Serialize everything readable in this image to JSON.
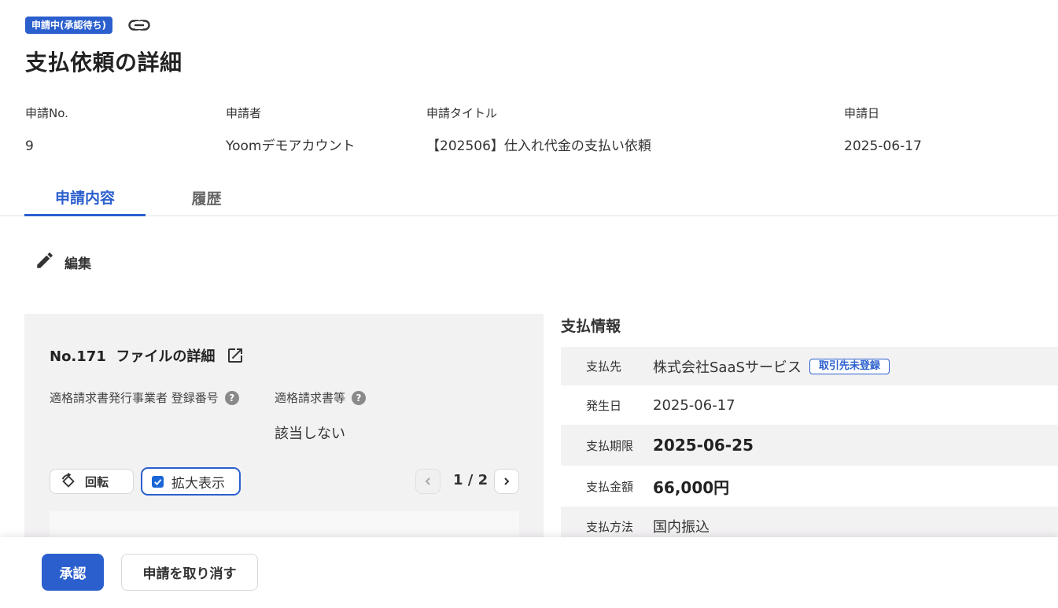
{
  "header": {
    "status_badge": "申請中(承認待ち)",
    "link_icon": "link-icon",
    "title": "支払依頼の詳細"
  },
  "meta": {
    "application_no": {
      "label": "申請No.",
      "value": "9"
    },
    "applicant": {
      "label": "申請者",
      "value": "Yoomデモアカウント"
    },
    "application_title": {
      "label": "申請タイトル",
      "value": "【202506】仕入れ代金の支払い依頼"
    },
    "application_date": {
      "label": "申請日",
      "value": "2025-06-17"
    }
  },
  "tabs": [
    {
      "label": "申請内容",
      "active": true
    },
    {
      "label": "履歴",
      "active": false
    }
  ],
  "edit": {
    "icon": "pencil-icon",
    "label": "編集"
  },
  "file_panel": {
    "title": "No.171  ファイルの詳細",
    "external_icon": "external-link-icon",
    "registration_label": "適格請求書発行事業者 登録番号",
    "invoice_label": "適格請求書等",
    "invoice_value": "該当しない",
    "help_icon": "?",
    "rotate_label": "回転",
    "zoom_label": "拡大表示",
    "zoom_checked": true,
    "page_indicator": "1 / 2"
  },
  "payment": {
    "title": "支払情報",
    "payee": {
      "label": "支払先",
      "value": "株式会社SaaSサービス",
      "badge": "取引先未登録"
    },
    "occurrence_date": {
      "label": "発生日",
      "value": "2025-06-17"
    },
    "due_date": {
      "label": "支払期限",
      "value": "2025-06-25"
    },
    "amount": {
      "label": "支払金額",
      "value": "66,000円"
    },
    "method": {
      "label": "支払方法",
      "value": "国内振込"
    }
  },
  "footer": {
    "approve_label": "承認",
    "cancel_label": "申請を取り消す"
  },
  "colors": {
    "accent": "#2b5fce",
    "panel_bg": "#f3f2f3"
  }
}
